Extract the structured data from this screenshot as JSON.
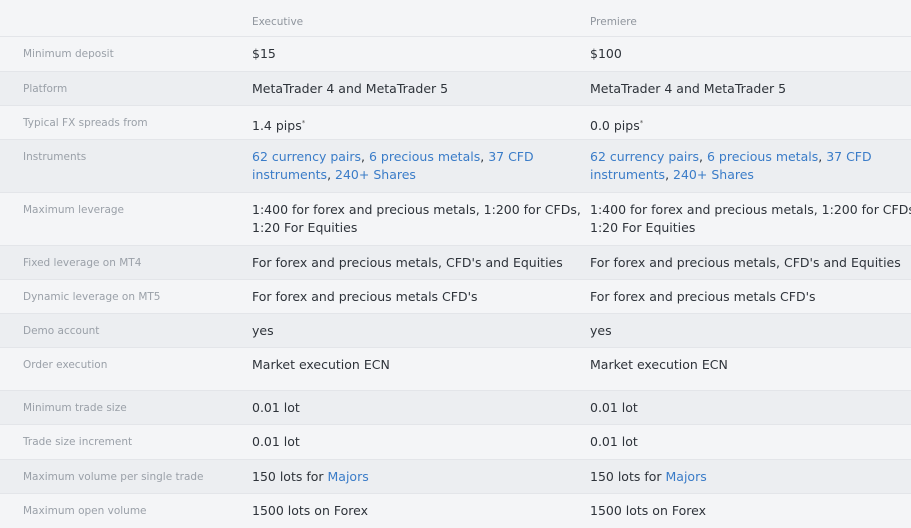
{
  "columns": {
    "executive": "Executive",
    "premiere": "Premiere"
  },
  "rows": {
    "min_deposit": {
      "label": "Minimum deposit",
      "executive": "$15",
      "premiere": "$100"
    },
    "platform": {
      "label": "Platform",
      "executive": "MetaTrader 4 and MetaTrader 5",
      "premiere": "MetaTrader 4 and MetaTrader 5"
    },
    "spreads": {
      "label": "Typical FX spreads from",
      "executive": "1.4 pips",
      "premiere": "0.0 pips",
      "marker": "*"
    },
    "instruments": {
      "label": "Instruments",
      "links": [
        "62 currency pairs",
        "6 precious metals",
        "37 CFD instruments",
        "240+ Shares"
      ],
      "sep": ", "
    },
    "max_leverage": {
      "label": "Maximum leverage",
      "line1": "1:400 for forex and precious metals, 1:200 for CFDs,",
      "line2": "1:20 For Equities"
    },
    "fixed_leverage": {
      "label": "Fixed leverage on MT4",
      "executive": "For forex and precious metals, CFD's and Equities",
      "premiere": "For forex and precious metals, CFD's and Equities"
    },
    "dynamic_leverage": {
      "label": "Dynamic leverage on MT5",
      "executive": "For forex and precious metals CFD's",
      "premiere": "For forex and precious metals CFD's"
    },
    "demo": {
      "label": "Demo account",
      "executive": "yes",
      "premiere": "yes"
    },
    "execution": {
      "label": "Order execution",
      "executive": "Market execution ECN",
      "premiere": "Market execution ECN"
    },
    "min_trade": {
      "label": "Minimum trade size",
      "executive": "0.01 lot",
      "premiere": "0.01 lot"
    },
    "increment": {
      "label": "Trade size increment",
      "executive": "0.01 lot",
      "premiere": "0.01 lot"
    },
    "max_volume_single": {
      "label": "Maximum volume per single trade",
      "prefix": "150 lots for",
      "link": "Majors"
    },
    "max_open_volume": {
      "label": "Maximum open volume",
      "executive": "1500 lots on Forex",
      "premiere": "1500 lots on Forex"
    }
  }
}
